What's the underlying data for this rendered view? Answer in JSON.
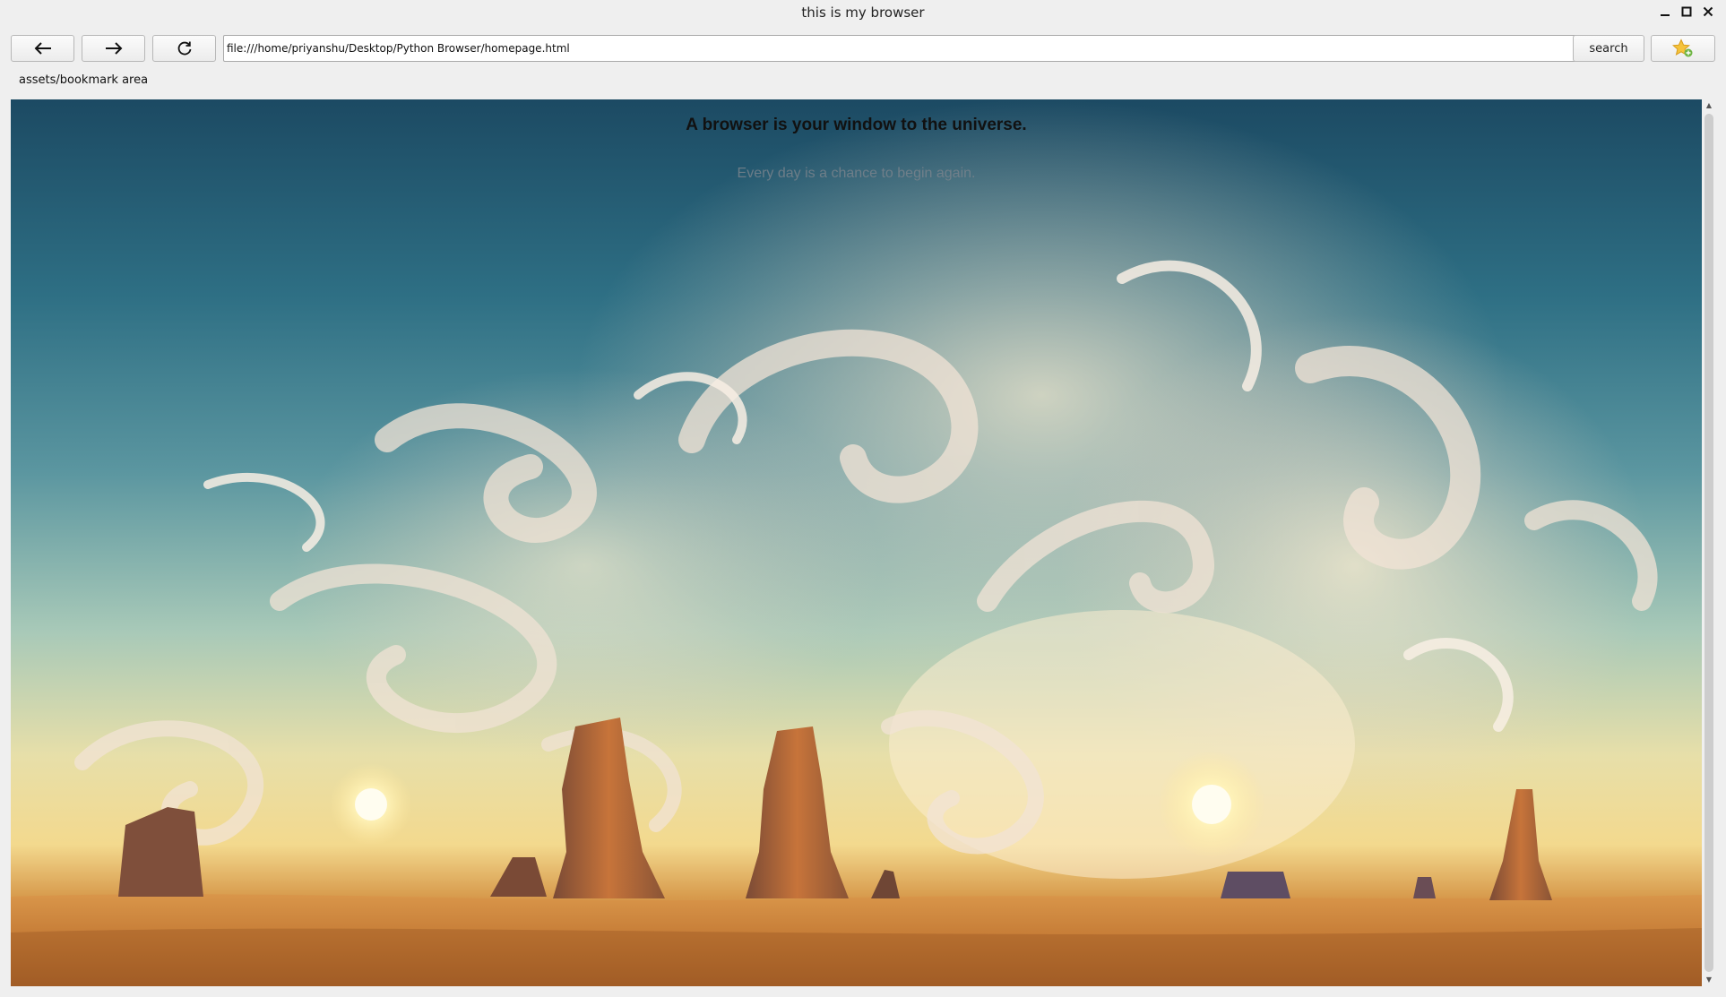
{
  "window": {
    "title": "this is my browser",
    "controls": [
      "minimize",
      "maximize",
      "close"
    ]
  },
  "toolbar": {
    "back_icon": "arrow-left-icon",
    "forward_icon": "arrow-right-icon",
    "reload_icon": "reload-icon",
    "url": "file:///home/priyanshu/Desktop/Python Browser/homepage.html",
    "search_label": "search",
    "bookmark_icon": "star-add-icon"
  },
  "bookmarks": {
    "label": "assets/bookmark area"
  },
  "page": {
    "heading": "A browser is your window to the universe.",
    "subtext": "Every day is a chance to begin again."
  }
}
